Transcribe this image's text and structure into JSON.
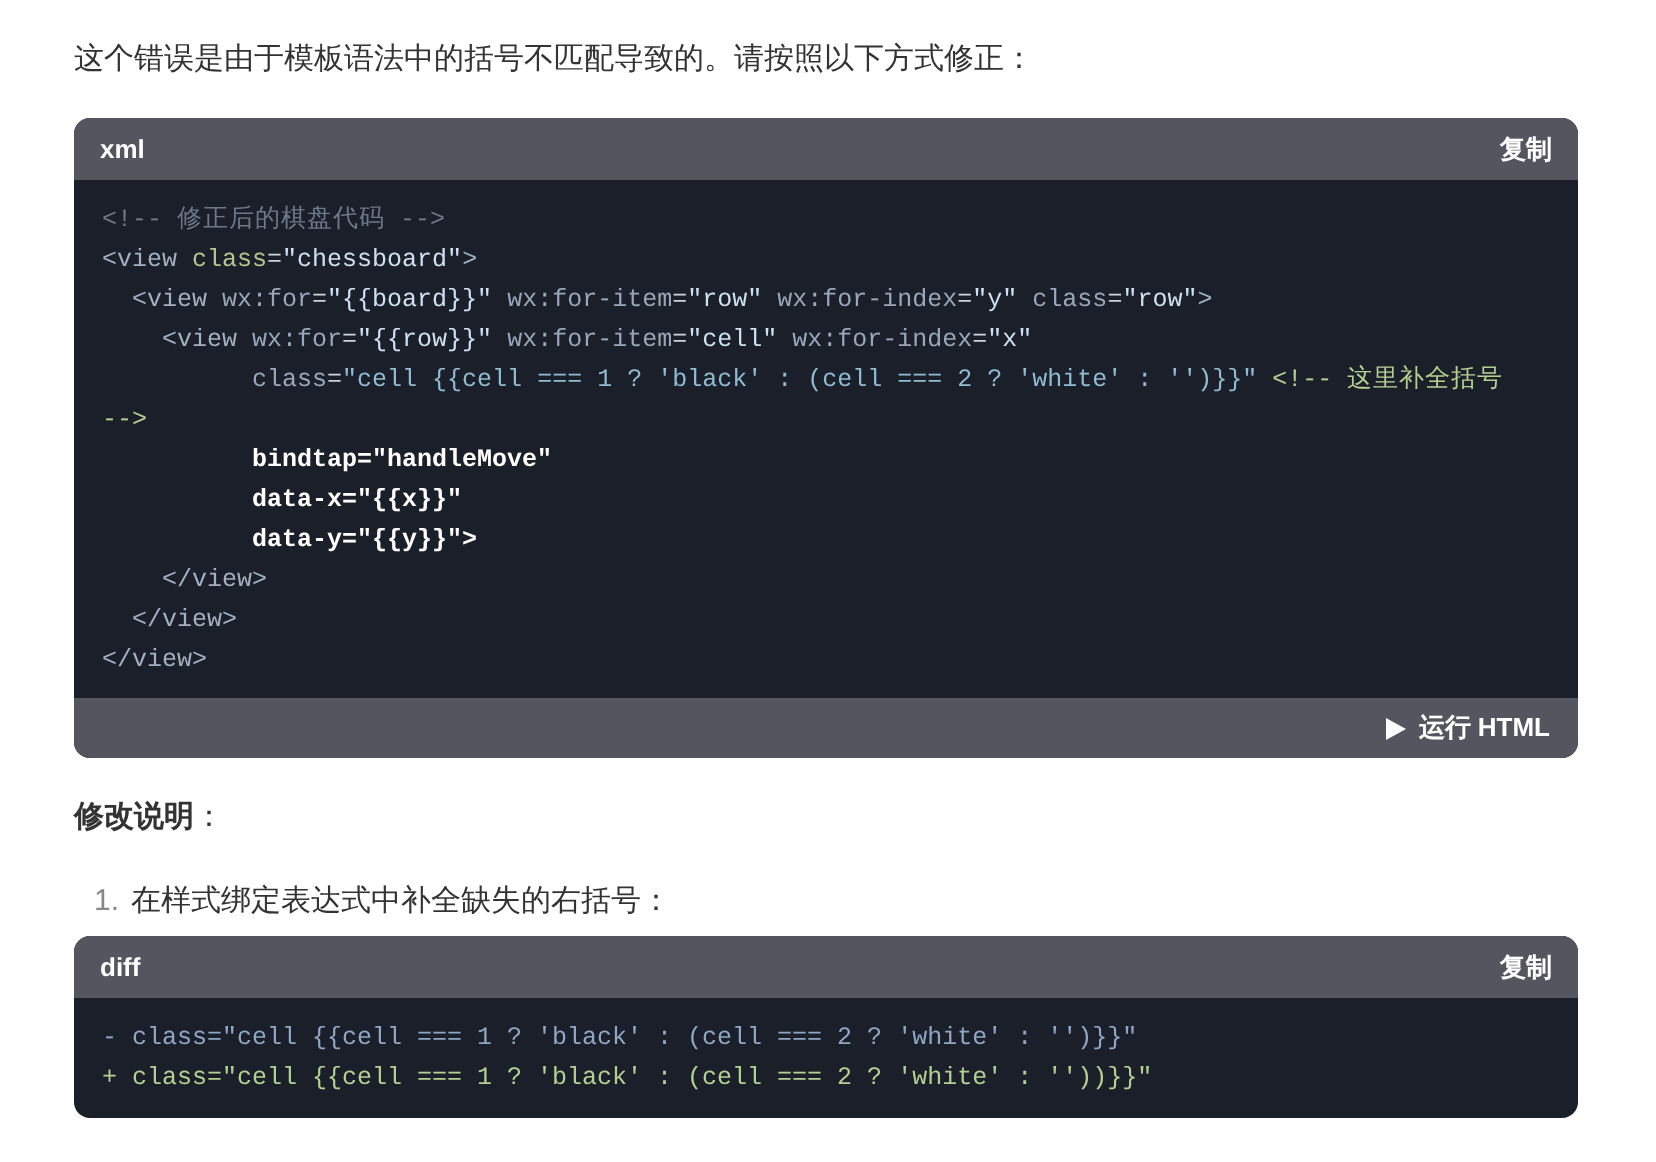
{
  "intro": "这个错误是由于模板语法中的括号不匹配导致的。请按照以下方式修正：",
  "code_block": {
    "language": "xml",
    "copy_label": "复制",
    "run_label": "运行 HTML",
    "lines": [
      [
        {
          "kind": "comment",
          "text": "<!-- 修正后的棋盘代码 -->"
        }
      ],
      [
        {
          "kind": "tag",
          "text": "<view "
        },
        {
          "kind": "attr",
          "text": "class"
        },
        {
          "kind": "plain",
          "text": "="
        },
        {
          "kind": "string",
          "text": "\"chessboard\""
        },
        {
          "kind": "tag",
          "text": ">"
        }
      ],
      [
        {
          "kind": "tag",
          "text": "  <view "
        },
        {
          "kind": "attr2",
          "text": "wx:for"
        },
        {
          "kind": "plain",
          "text": "="
        },
        {
          "kind": "string",
          "text": "\"{{board}}\""
        },
        {
          "kind": "attr2",
          "text": " wx:for-item"
        },
        {
          "kind": "plain",
          "text": "="
        },
        {
          "kind": "string",
          "text": "\"row\""
        },
        {
          "kind": "attr2",
          "text": " wx:for-index"
        },
        {
          "kind": "plain",
          "text": "="
        },
        {
          "kind": "string",
          "text": "\"y\""
        },
        {
          "kind": "attr2",
          "text": " class"
        },
        {
          "kind": "plain",
          "text": "="
        },
        {
          "kind": "string",
          "text": "\"row\""
        },
        {
          "kind": "tag",
          "text": ">"
        }
      ],
      [
        {
          "kind": "tag",
          "text": "    <view "
        },
        {
          "kind": "attr2",
          "text": "wx:for"
        },
        {
          "kind": "plain",
          "text": "="
        },
        {
          "kind": "string",
          "text": "\"{{row}}\""
        },
        {
          "kind": "attr2",
          "text": " wx:for-item"
        },
        {
          "kind": "plain",
          "text": "="
        },
        {
          "kind": "string",
          "text": "\"cell\""
        },
        {
          "kind": "attr2",
          "text": " wx:for-index"
        },
        {
          "kind": "plain",
          "text": "="
        },
        {
          "kind": "string",
          "text": "\"x\""
        }
      ],
      [
        {
          "kind": "attr2",
          "text": "          class"
        },
        {
          "kind": "plain",
          "text": "="
        },
        {
          "kind": "string2",
          "text": "\"cell {{cell === 1 ? 'black' : (cell === 2 ? 'white' : '')}}\""
        },
        {
          "kind": "note",
          "text": " <!-- 这里补全括号"
        }
      ],
      [
        {
          "kind": "note",
          "text": "-->"
        }
      ],
      [
        {
          "kind": "bold",
          "text": "          bindtap=\"handleMove\""
        }
      ],
      [
        {
          "kind": "bold",
          "text": "          data-x=\"{{x}}\""
        }
      ],
      [
        {
          "kind": "bold",
          "text": "          data-y=\"{{y}}\">"
        }
      ],
      [
        {
          "kind": "tag",
          "text": "    </view>"
        }
      ],
      [
        {
          "kind": "tag",
          "text": "  </view>"
        }
      ],
      [
        {
          "kind": "tag",
          "text": "</view>"
        }
      ]
    ]
  },
  "section_heading": "修改说明",
  "section_colon": "：",
  "list_items": [
    {
      "number": "1.",
      "text": "在样式绑定表达式中补全缺失的右括号："
    }
  ],
  "diff_block": {
    "language": "diff",
    "copy_label": "复制",
    "lines": [
      {
        "kind": "removed",
        "text": "- class=\"cell {{cell === 1 ? 'black' : (cell === 2 ? 'white' : '')}}\""
      },
      {
        "kind": "added",
        "text": "+ class=\"cell {{cell === 1 ? 'black' : (cell === 2 ? 'white' : ''))}}\""
      }
    ]
  }
}
